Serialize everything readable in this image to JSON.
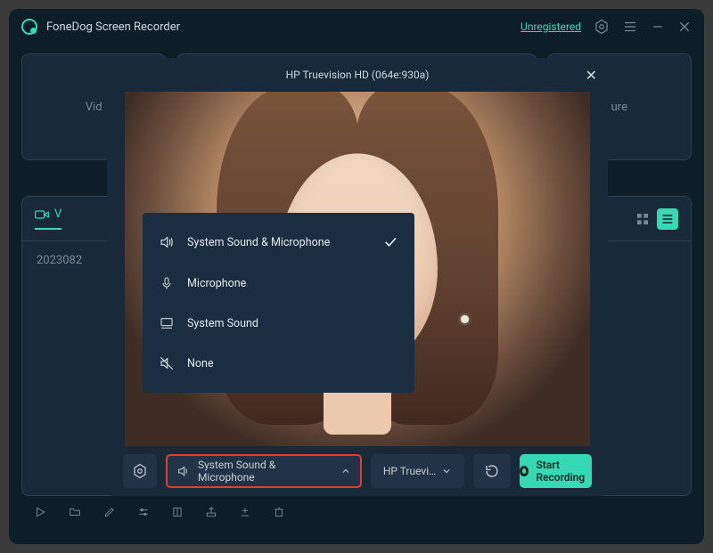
{
  "app": {
    "title": "FoneDog Screen Recorder"
  },
  "header": {
    "unregistered": "Unregistered"
  },
  "bg": {
    "card1": "Vid",
    "card2": "ure",
    "tab": "V",
    "file": "2023082"
  },
  "modal": {
    "title": "HP Truevision HD (064e:930a)"
  },
  "audio": {
    "options": [
      {
        "label": "System Sound & Microphone",
        "selected": true
      },
      {
        "label": "Microphone",
        "selected": false
      },
      {
        "label": "System Sound",
        "selected": false
      },
      {
        "label": "None",
        "selected": false
      }
    ]
  },
  "controls": {
    "audio_button": "System Sound & Microphone",
    "device_button": "HP Truevi…",
    "record_button": "Start Recording"
  }
}
